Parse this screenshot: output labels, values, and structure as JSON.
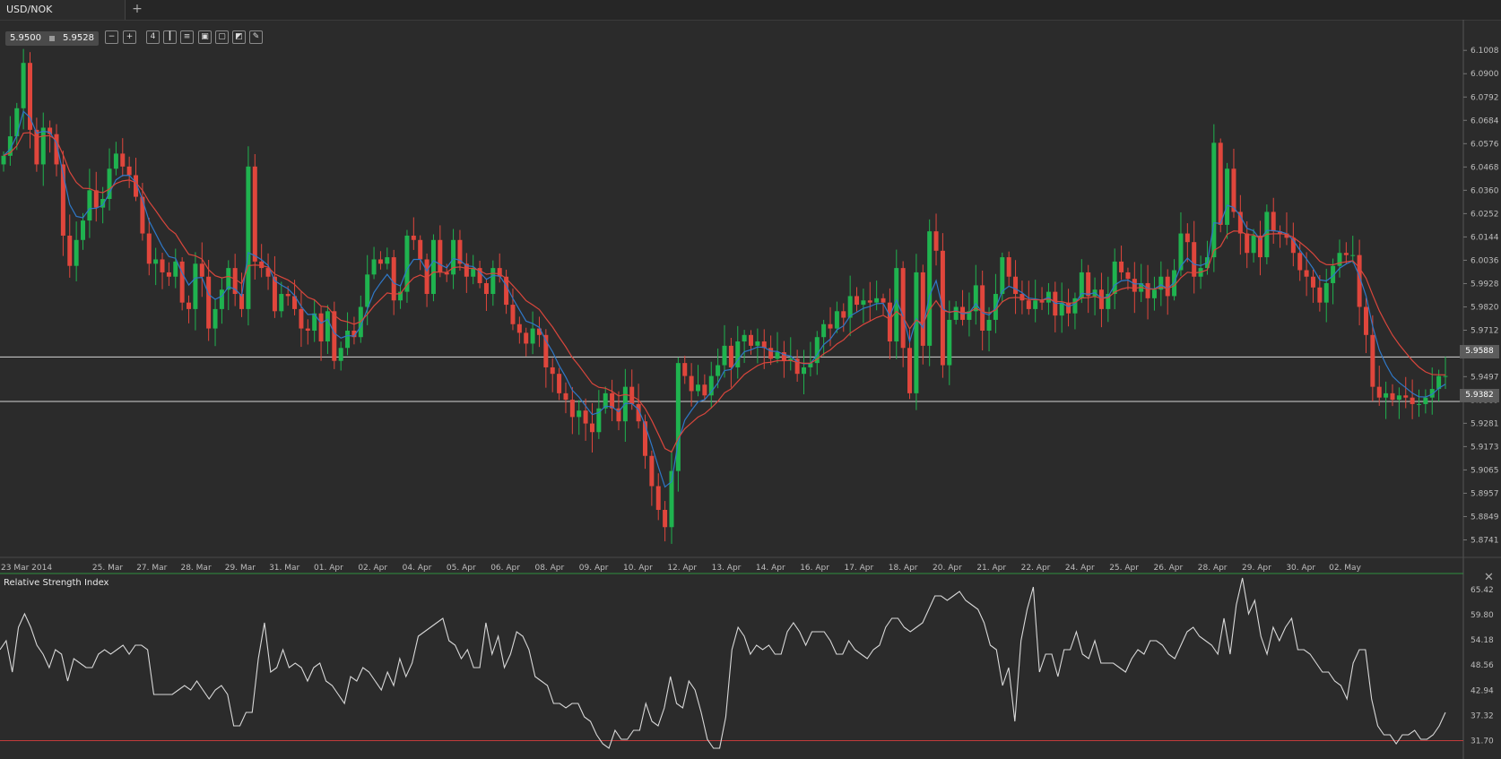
{
  "window": {
    "tab_label": "USD/NOK",
    "add_tab_label": "+"
  },
  "quote": {
    "bid": "5.9500",
    "ask": "5.9528"
  },
  "toolbar": {
    "icons": [
      "zoom-out-icon",
      "zoom-in-icon",
      "period-icon",
      "candles-icon",
      "indicators-icon",
      "templates-icon",
      "snapshot-icon",
      "objects-icon",
      "draw-icon"
    ],
    "period_label": "4"
  },
  "price_axis": {
    "ticks": [
      "6.1008",
      "6.0900",
      "6.0792",
      "6.0684",
      "6.0576",
      "6.0468",
      "6.0360",
      "6.0252",
      "6.0144",
      "6.0036",
      "5.9928",
      "5.9820",
      "5.9712",
      "5.9604",
      "5.9497",
      "5.9389",
      "5.9281",
      "5.9173",
      "5.9065",
      "5.8957",
      "5.8849",
      "5.8741"
    ]
  },
  "lines": {
    "upper_label": "5.9588",
    "lower_label": "5.9382",
    "upper": 5.9588,
    "lower": 5.9382
  },
  "time_axis": {
    "labels": [
      "23 Mar 2014",
      "25. Mar",
      "27. Mar",
      "28. Mar",
      "29. Mar",
      "31. Mar",
      "01. Apr",
      "02. Apr",
      "04. Apr",
      "05. Apr",
      "06. Apr",
      "08. Apr",
      "09. Apr",
      "10. Apr",
      "12. Apr",
      "13. Apr",
      "14. Apr",
      "16. Apr",
      "17. Apr",
      "18. Apr",
      "20. Apr",
      "21. Apr",
      "22. Apr",
      "24. Apr",
      "25. Apr",
      "26. Apr",
      "28. Apr",
      "29. Apr",
      "30. Apr",
      "02. May"
    ]
  },
  "rsi": {
    "title": "Relative Strength Index",
    "ticks": [
      "65.42",
      "59.80",
      "54.18",
      "48.56",
      "42.94",
      "37.32",
      "31.70"
    ],
    "level": 31.7
  },
  "colors": {
    "up": "#1fb34f",
    "down": "#e0463c",
    "ma_blue": "#2f78c8",
    "ma_red": "#d9463c",
    "rsi": "#d8d8d8",
    "level": "#c23b3b"
  },
  "chart_data": [
    {
      "type": "candlestick",
      "title": "USD/NOK",
      "ylim": [
        5.866,
        6.115
      ],
      "close": [
        6.052,
        6.061,
        6.074,
        6.095,
        6.064,
        6.048,
        6.065,
        6.062,
        6.048,
        6.015,
        6.001,
        6.013,
        6.022,
        6.036,
        6.028,
        6.032,
        6.046,
        6.053,
        6.047,
        6.043,
        6.033,
        6.016,
        6.002,
        6.004,
        5.998,
        5.996,
        6.003,
        5.984,
        5.981,
        6.002,
        5.996,
        5.972,
        5.981,
        5.99,
        6.0,
        5.988,
        5.981,
        6.047,
        6.003,
        6.0,
        5.996,
        5.98,
        5.988,
        5.987,
        5.981,
        5.972,
        5.971,
        5.979,
        5.966,
        5.98,
        5.957,
        5.963,
        5.971,
        5.968,
        5.982,
        5.997,
        6.004,
        6.002,
        6.005,
        5.985,
        5.989,
        6.015,
        6.013,
        6.004,
        5.988,
        6.013,
        5.998,
        5.997,
        6.013,
        6.002,
        5.996,
        6.0,
        5.993,
        5.988,
        6.0,
        5.996,
        5.983,
        5.974,
        5.97,
        5.965,
        5.972,
        5.969,
        5.954,
        5.951,
        5.942,
        5.939,
        5.931,
        5.934,
        5.928,
        5.924,
        5.935,
        5.942,
        5.935,
        5.929,
        5.945,
        5.937,
        5.929,
        5.913,
        5.899,
        5.888,
        5.88,
        5.906,
        5.956,
        5.95,
        5.943,
        5.946,
        5.941,
        5.95,
        5.955,
        5.964,
        5.954,
        5.966,
        5.969,
        5.964,
        5.966,
        5.963,
        5.958,
        5.961,
        5.957,
        5.958,
        5.951,
        5.954,
        5.956,
        5.968,
        5.974,
        5.972,
        5.98,
        5.977,
        5.987,
        5.983,
        5.985,
        5.984,
        5.986,
        5.984,
        5.966,
        6.0,
        5.963,
        5.942,
        5.998,
        5.964,
        6.017,
        6.008,
        5.955,
        5.976,
        5.982,
        5.976,
        5.98,
        5.992,
        5.971,
        5.976,
        5.988,
        6.005,
        5.996,
        5.988,
        5.985,
        5.981,
        5.985,
        5.984,
        5.989,
        5.978,
        5.984,
        5.979,
        5.986,
        5.998,
        5.987,
        5.99,
        5.981,
        5.988,
        6.003,
        5.998,
        5.995,
        5.989,
        5.993,
        5.986,
        5.99,
        5.996,
        5.987,
        5.999,
        6.016,
        6.012,
        5.996,
        6.0,
        6.005,
        6.058,
        6.02,
        6.046,
        6.026,
        6.016,
        6.007,
        6.015,
        6.005,
        6.026,
        6.017,
        6.016,
        6.014,
        6.007,
        5.999,
        5.996,
        5.991,
        5.984,
        5.993,
        6.001,
        6.007,
        6.006,
        6.006,
        5.982,
        5.969,
        5.945,
        5.94,
        5.942,
        5.939,
        5.941,
        5.94,
        5.937,
        5.937,
        5.94,
        5.944,
        5.95,
        5.95
      ],
      "ma_fast": "blue",
      "ma_slow": "red"
    },
    {
      "type": "line",
      "title": "Relative Strength Index",
      "ylim": [
        29,
        68
      ],
      "values": [
        52,
        54,
        47,
        57,
        60,
        57,
        53,
        51,
        48,
        52,
        51,
        45,
        50,
        49,
        48,
        48,
        51,
        52,
        51,
        52,
        53,
        51,
        53,
        53,
        52,
        42,
        42,
        42,
        42,
        43,
        44,
        43,
        45,
        43,
        41,
        43,
        44,
        42,
        35,
        35,
        38,
        38,
        50,
        58,
        47,
        48,
        52,
        48,
        49,
        48,
        45,
        48,
        49,
        45,
        44,
        42,
        40,
        46,
        45,
        48,
        47,
        45,
        43,
        47,
        44,
        50,
        46,
        49,
        55,
        56,
        57,
        58,
        59,
        54,
        53,
        50,
        52,
        48,
        48,
        58,
        51,
        55,
        48,
        51,
        56,
        55,
        52,
        46,
        45,
        44,
        40,
        40,
        39,
        40,
        40,
        37,
        36,
        33,
        31,
        30,
        34,
        32,
        32,
        34,
        34,
        40,
        36,
        35,
        39,
        46,
        40,
        39,
        45,
        43,
        38,
        32,
        30,
        30,
        37,
        52,
        57,
        55,
        51,
        53,
        52,
        53,
        51,
        51,
        56,
        58,
        56,
        53,
        56,
        56,
        56,
        54,
        51,
        51,
        54,
        52,
        51,
        50,
        52,
        53,
        57,
        59,
        59,
        57,
        56,
        57,
        58,
        61,
        64,
        64,
        63,
        64,
        65,
        63,
        62,
        61,
        58,
        53,
        52,
        44,
        48,
        36,
        54,
        61,
        66,
        47,
        51,
        51,
        46,
        52,
        52,
        56,
        51,
        50,
        54,
        49,
        49,
        49,
        48,
        47,
        50,
        52,
        51,
        54,
        54,
        53,
        51,
        50,
        53,
        56,
        57,
        55,
        54,
        53,
        51,
        59,
        51,
        62,
        68,
        60,
        63,
        55,
        51,
        57,
        54,
        57,
        59,
        52,
        52,
        51,
        49,
        47,
        47,
        45,
        44,
        41,
        49,
        52,
        52,
        41,
        35,
        33,
        33,
        31,
        33,
        33,
        34,
        32,
        32,
        33,
        35,
        38
      ]
    }
  ]
}
